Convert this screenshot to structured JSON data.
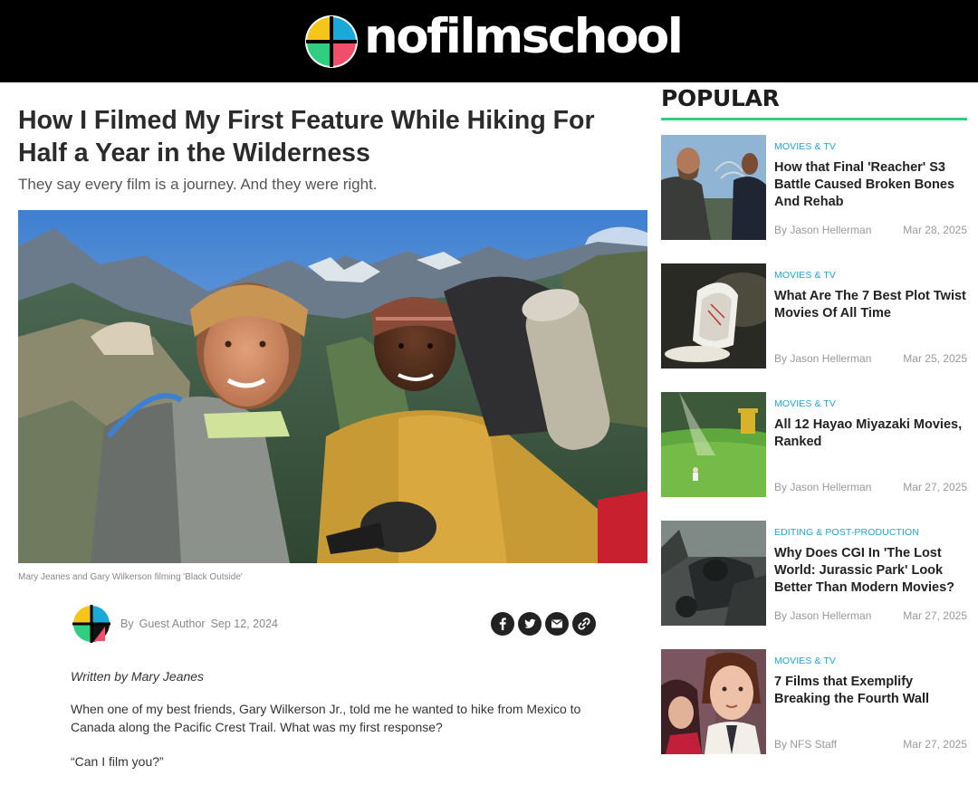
{
  "site": {
    "logo_text": "nofilmschool",
    "brand_colors": [
      "#f5c518",
      "#19a8d8",
      "#ef4f6b",
      "#2fcf7f"
    ]
  },
  "article": {
    "headline": "How I Filmed My First Feature While Hiking For Half a Year in the Wilderness",
    "subhead": "They say every film is a journey. And they were right.",
    "image_caption": "Mary Jeanes and Gary Wilkerson filming 'Black Outside'",
    "byline": {
      "prefix": "By",
      "author": "Guest Author",
      "date": "Sep 12, 2024"
    },
    "share_icons": [
      "facebook-icon",
      "twitter-icon",
      "email-icon",
      "link-icon"
    ],
    "written_by": "Written by Mary Jeanes",
    "paragraphs": [
      "When one of my best friends, Gary Wilkerson Jr., told me he wanted to hike from Mexico to Canada along the Pacific Crest Trail. What was my first response?",
      "“Can I film you?”"
    ]
  },
  "sidebar": {
    "title": "POPULAR",
    "accent_color": "#2fcf7f",
    "items": [
      {
        "category": "MOVIES & TV",
        "title": "How that Final 'Reacher' S3 Battle Caused Broken Bones And Rehab",
        "author": "By Jason Hellerman",
        "date": "Mar 28, 2025"
      },
      {
        "category": "MOVIES & TV",
        "title": "What Are The 7 Best Plot Twist Movies Of All Time",
        "author": "By Jason Hellerman",
        "date": "Mar 25, 2025"
      },
      {
        "category": "MOVIES & TV",
        "title": "All 12 Hayao Miyazaki Movies, Ranked",
        "author": "By Jason Hellerman",
        "date": "Mar 27, 2025"
      },
      {
        "category": "EDITING & POST-PRODUCTION",
        "title": "Why Does CGI In 'The Lost World: Jurassic Park' Look Better Than Modern Movies?",
        "author": "By Jason Hellerman",
        "date": "Mar 27, 2025"
      },
      {
        "category": "MOVIES & TV",
        "title": "7 Films that Exemplify Breaking the Fourth Wall",
        "author": "By NFS Staff",
        "date": "Mar 27, 2025"
      }
    ]
  }
}
